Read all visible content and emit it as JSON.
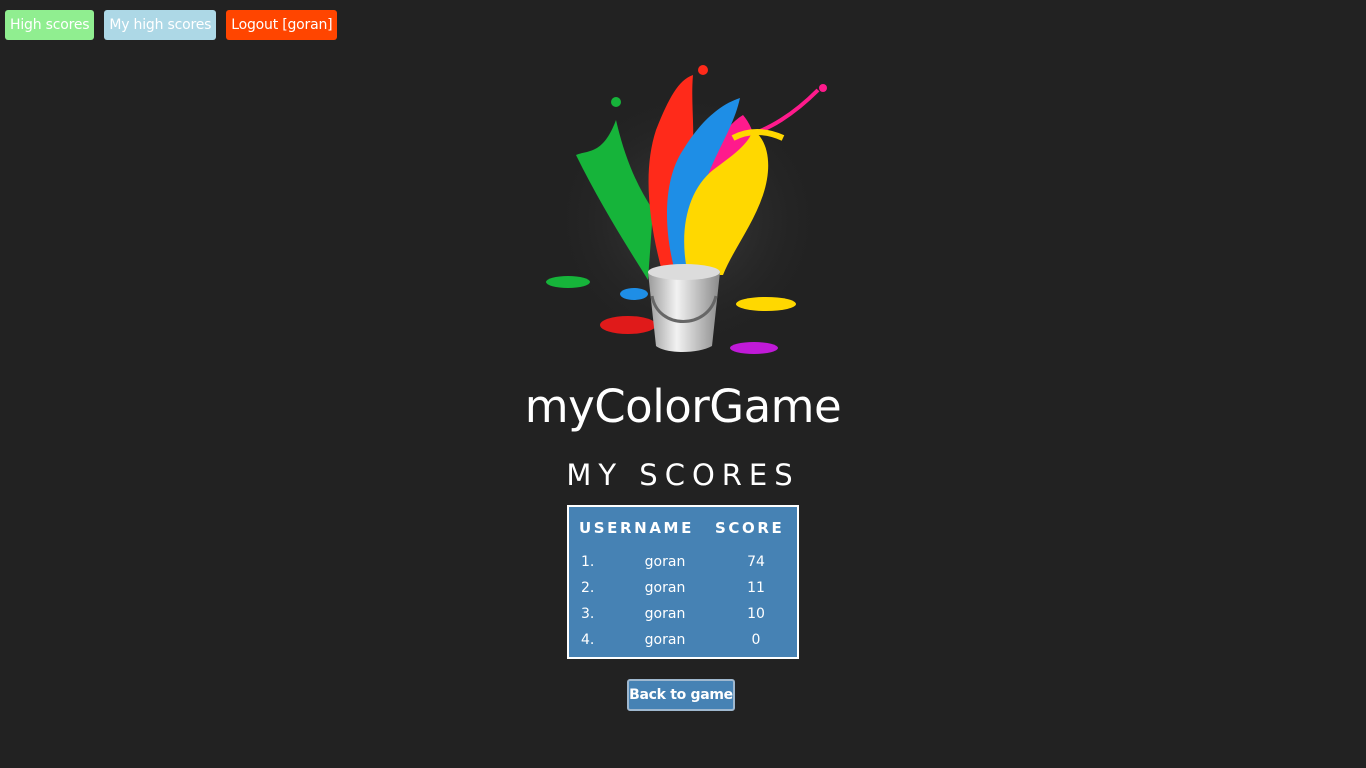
{
  "nav": {
    "high_scores": "High scores",
    "my_high_scores": "My high scores",
    "logout": "Logout [goran]"
  },
  "logo": {
    "icon": "paint-bucket-splash-icon",
    "colors": [
      "#16b43a",
      "#ff2a1a",
      "#1e8ee6",
      "#ff1a8c",
      "#ffd800",
      "#c01ad8"
    ]
  },
  "title": "myColorGame",
  "subtitle": "MY SCORES",
  "scores": {
    "headers": {
      "username": "USERNAME",
      "score": "SCORE"
    },
    "rows": [
      {
        "rank": "1.",
        "username": "goran",
        "score": "74"
      },
      {
        "rank": "2.",
        "username": "goran",
        "score": "11"
      },
      {
        "rank": "3.",
        "username": "goran",
        "score": "10"
      },
      {
        "rank": "4.",
        "username": "goran",
        "score": "0"
      }
    ]
  },
  "back_button": "Back to game",
  "colors": {
    "background": "#222222",
    "high_scores_button": "#90ee90",
    "my_high_scores_button": "#add8e6",
    "logout_button": "#ff4500",
    "table_background": "#4682b4"
  }
}
